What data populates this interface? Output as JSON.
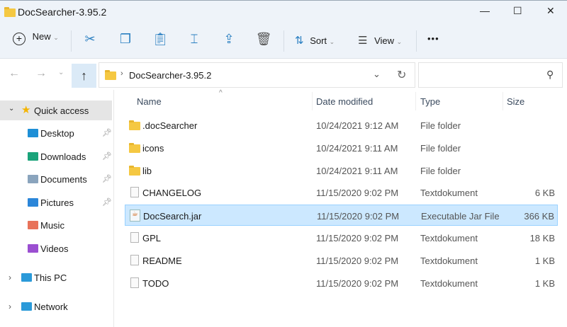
{
  "window": {
    "title": "DocSearcher-3.95.2",
    "minimize": "—",
    "maximize": "☐",
    "close": "✕"
  },
  "toolbar": {
    "new_label": "New",
    "sort_label": "Sort",
    "view_label": "View",
    "more": "•••"
  },
  "nav": {
    "breadcrumb": "DocSearcher-3.95.2",
    "search_placeholder": ""
  },
  "columns": {
    "name": "Name",
    "date": "Date modified",
    "type": "Type",
    "size": "Size"
  },
  "files": [
    {
      "name": ".docSearcher",
      "date": "10/24/2021 9:12 AM",
      "type": "File folder",
      "size": "",
      "kind": "folder"
    },
    {
      "name": "icons",
      "date": "10/24/2021 9:11 AM",
      "type": "File folder",
      "size": "",
      "kind": "folder"
    },
    {
      "name": "lib",
      "date": "10/24/2021 9:11 AM",
      "type": "File folder",
      "size": "",
      "kind": "folder"
    },
    {
      "name": "CHANGELOG",
      "date": "11/15/2020 9:02 PM",
      "type": "Textdokument",
      "size": "6 KB",
      "kind": "doc"
    },
    {
      "name": "DocSearch.jar",
      "date": "11/15/2020 9:02 PM",
      "type": "Executable Jar File",
      "size": "366 KB",
      "kind": "jar",
      "selected": true
    },
    {
      "name": "GPL",
      "date": "11/15/2020 9:02 PM",
      "type": "Textdokument",
      "size": "18 KB",
      "kind": "doc"
    },
    {
      "name": "README",
      "date": "11/15/2020 9:02 PM",
      "type": "Textdokument",
      "size": "1 KB",
      "kind": "doc"
    },
    {
      "name": "TODO",
      "date": "11/15/2020 9:02 PM",
      "type": "Textdokument",
      "size": "1 KB",
      "kind": "doc"
    }
  ],
  "sidebar": {
    "quick_access": "Quick access",
    "items": [
      {
        "label": "Desktop",
        "color": "#1e8fd6",
        "pinned": true
      },
      {
        "label": "Downloads",
        "color": "#1aa37a",
        "pinned": true
      },
      {
        "label": "Documents",
        "color": "#8aa4bd",
        "pinned": true
      },
      {
        "label": "Pictures",
        "color": "#2b86d9",
        "pinned": true
      },
      {
        "label": "Music",
        "color": "#e8735a",
        "pinned": false
      },
      {
        "label": "Videos",
        "color": "#9b4fd1",
        "pinned": false
      }
    ],
    "this_pc": "This PC",
    "network": "Network"
  }
}
